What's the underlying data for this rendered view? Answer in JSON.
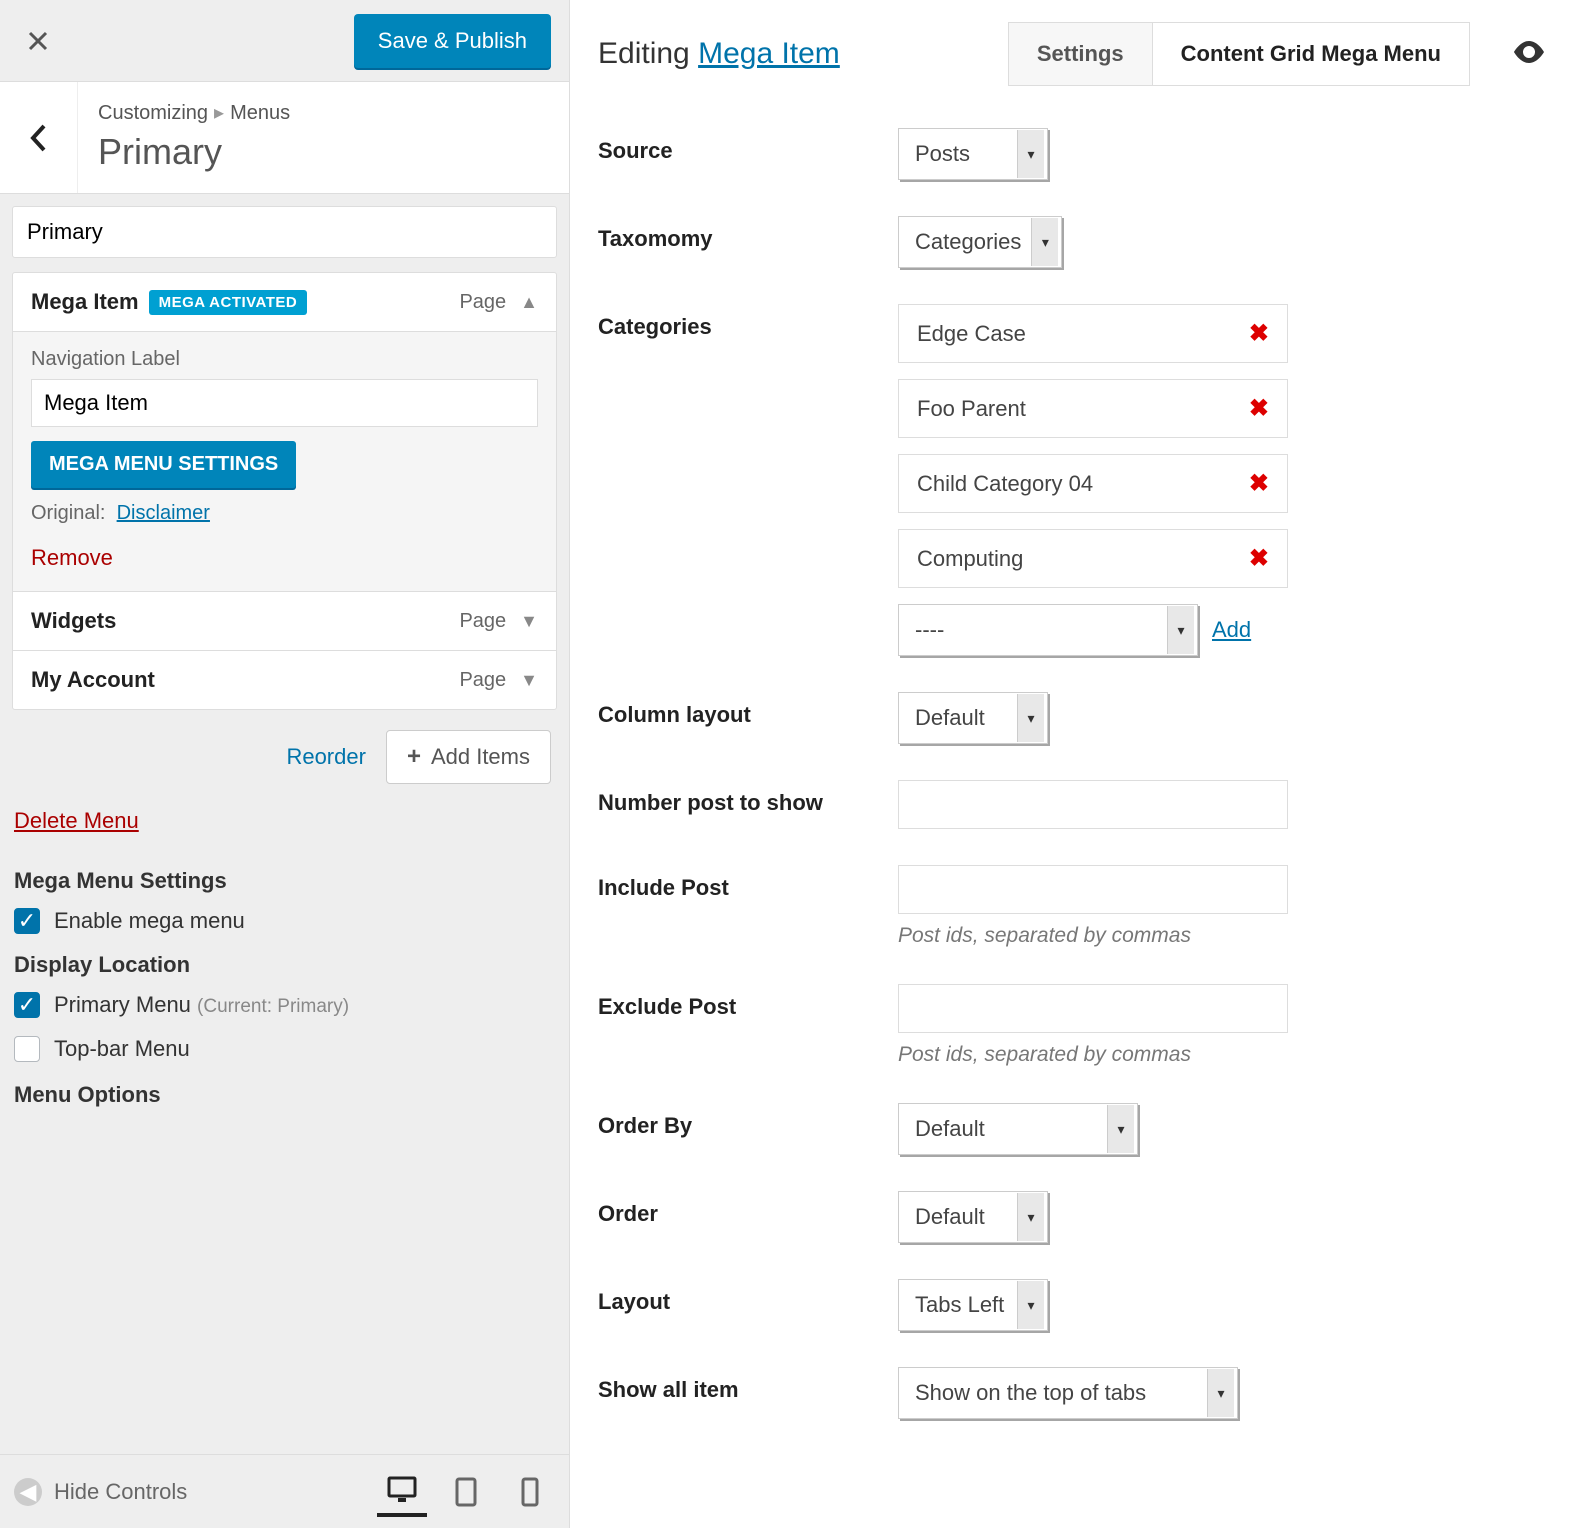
{
  "sidebar": {
    "save_label": "Save & Publish",
    "breadcrumb_root": "Customizing",
    "breadcrumb_current": "Menus",
    "panel_title": "Primary",
    "menu_name_value": "Primary",
    "expanded_item": {
      "title": "Mega Item",
      "badge": "MEGA ACTIVATED",
      "type": "Page",
      "nav_label_label": "Navigation Label",
      "nav_label_value": "Mega Item",
      "mega_settings_btn": "MEGA MENU SETTINGS",
      "original_label": "Original:",
      "original_link": "Disclaimer",
      "remove_label": "Remove"
    },
    "items": [
      {
        "title": "Widgets",
        "type": "Page"
      },
      {
        "title": "My Account",
        "type": "Page"
      }
    ],
    "reorder_label": "Reorder",
    "add_items_label": "Add Items",
    "delete_menu_label": "Delete Menu",
    "mega_settings_h": "Mega Menu Settings",
    "enable_mega_label": "Enable mega menu",
    "display_loc_h": "Display Location",
    "loc_primary_label": "Primary Menu",
    "loc_primary_hint": "(Current: Primary)",
    "loc_topbar_label": "Top-bar Menu",
    "menu_options_h": "Menu Options",
    "hide_controls_label": "Hide Controls"
  },
  "main": {
    "editing_prefix": "Editing",
    "editing_item": "Mega Item",
    "tabs": {
      "settings": "Settings",
      "content_grid": "Content Grid Mega Menu"
    },
    "fields": {
      "source": {
        "label": "Source",
        "value": "Posts"
      },
      "taxonomy": {
        "label": "Taxomomy",
        "value": "Categories"
      },
      "categories": {
        "label": "Categories",
        "tags": [
          "Edge Case",
          "Foo Parent",
          "Child Category 04",
          "Computing"
        ],
        "placeholder_select": "----",
        "add_label": "Add"
      },
      "column_layout": {
        "label": "Column layout",
        "value": "Default"
      },
      "num_posts": {
        "label": "Number post to show",
        "value": ""
      },
      "include_post": {
        "label": "Include Post",
        "value": "",
        "hint": "Post ids, separated by commas"
      },
      "exclude_post": {
        "label": "Exclude Post",
        "value": "",
        "hint": "Post ids, separated by commas"
      },
      "order_by": {
        "label": "Order By",
        "value": "Default"
      },
      "order": {
        "label": "Order",
        "value": "Default"
      },
      "layout": {
        "label": "Layout",
        "value": "Tabs Left"
      },
      "show_all": {
        "label": "Show all item",
        "value": "Show on the top of tabs"
      }
    }
  }
}
